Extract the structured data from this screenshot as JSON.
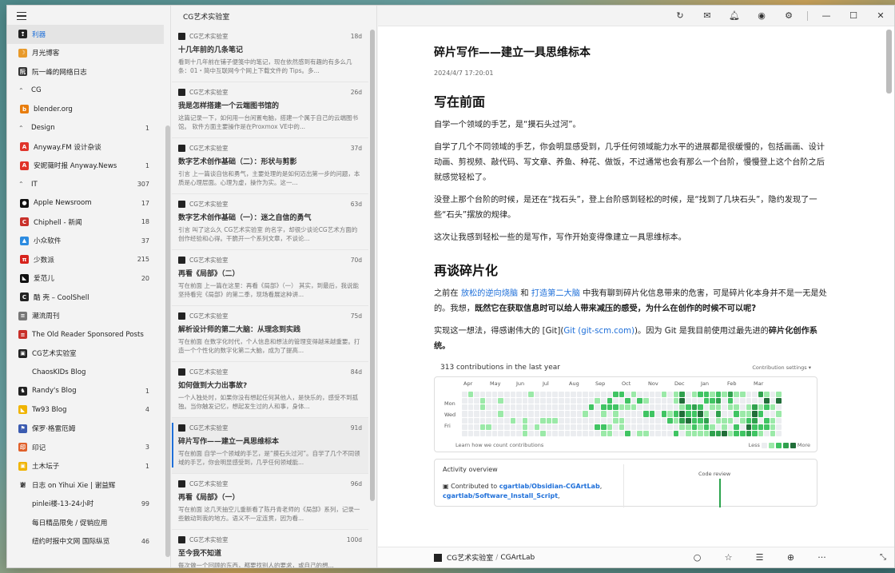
{
  "sidebar": {
    "items": [
      {
        "type": "feed",
        "label": "利器",
        "count": "",
        "selected": true,
        "fav_color": "#222",
        "fav_glyph": "❢"
      },
      {
        "type": "feed",
        "label": "月光博客",
        "count": "",
        "fav_color": "#e89a2b",
        "fav_glyph": "☽"
      },
      {
        "type": "feed",
        "label": "阮一峰的网络日志",
        "count": "",
        "fav_color": "#333",
        "fav_glyph": "阮"
      },
      {
        "type": "group",
        "label": "CG",
        "count": ""
      },
      {
        "type": "feed",
        "label": "blender.org",
        "count": "",
        "fav_color": "#e87d0d",
        "fav_glyph": "b",
        "child": true
      },
      {
        "type": "group",
        "label": "Design",
        "count": "1"
      },
      {
        "type": "feed",
        "label": "Anyway.FM 设计杂谈",
        "count": "",
        "fav_color": "#e0342a",
        "fav_glyph": "A",
        "child": true
      },
      {
        "type": "feed",
        "label": "安妮薇时报 Anyway.News",
        "count": "1",
        "fav_color": "#e0342a",
        "fav_glyph": "A",
        "child": true
      },
      {
        "type": "group",
        "label": "IT",
        "count": "307"
      },
      {
        "type": "feed",
        "label": "Apple Newsroom",
        "count": "17",
        "fav_color": "#111",
        "fav_glyph": "●",
        "child": true
      },
      {
        "type": "feed",
        "label": "Chiphell - 新闻",
        "count": "18",
        "fav_color": "#c8302a",
        "fav_glyph": "C",
        "child": true
      },
      {
        "type": "feed",
        "label": "小众软件",
        "count": "37",
        "fav_color": "#2c8be0",
        "fav_glyph": "▲",
        "child": true
      },
      {
        "type": "feed",
        "label": "少数派",
        "count": "215",
        "fav_color": "#d7231c",
        "fav_glyph": "π",
        "child": true
      },
      {
        "type": "feed",
        "label": "爱范儿",
        "count": "20",
        "fav_color": "#111",
        "fav_glyph": "◣",
        "child": true
      },
      {
        "type": "feed",
        "label": "酷 壳 – CoolShell",
        "count": "",
        "fav_color": "#222",
        "fav_glyph": "C",
        "child": true
      },
      {
        "type": "feed",
        "label": "潮流周刊",
        "count": "",
        "fav_color": "#777",
        "fav_glyph": "≡"
      },
      {
        "type": "feed",
        "label": "The Old Reader Sponsored Posts",
        "count": "",
        "fav_color": "#c8302a",
        "fav_glyph": "≡"
      },
      {
        "type": "feed",
        "label": "CG艺术实验室",
        "count": "",
        "fav_color": "#222",
        "fav_glyph": "▣",
        "active": true
      },
      {
        "type": "feed",
        "label": "ChaosKIDs Blog",
        "count": "",
        "fav_color": "#f3f3f3",
        "fav_glyph": ""
      },
      {
        "type": "feed",
        "label": "Randy's Blog",
        "count": "1",
        "fav_color": "#222",
        "fav_glyph": "♞"
      },
      {
        "type": "feed",
        "label": "Tw93 Blog",
        "count": "4",
        "fav_color": "#f0b400",
        "fav_glyph": "◣"
      },
      {
        "type": "feed",
        "label": "保罗·格雷厄姆",
        "count": "",
        "fav_color": "#3b5bb0",
        "fav_glyph": "⚑"
      },
      {
        "type": "feed",
        "label": "印记",
        "count": "3",
        "fav_color": "#e0602a",
        "fav_glyph": "印"
      },
      {
        "type": "feed",
        "label": "土木坛子",
        "count": "1",
        "fav_color": "#f0b400",
        "fav_glyph": "▣"
      },
      {
        "type": "feed",
        "label": "日志 on Yihui Xie | 谢益辉",
        "count": "",
        "fav_color": "#f3f3f3",
        "fav_glyph": "谢",
        "glyph_color": "#222"
      },
      {
        "type": "feed",
        "label": "pinlei楼-13-24小时",
        "count": "99",
        "fav_color": "#f3f3f3",
        "fav_glyph": ""
      },
      {
        "type": "feed",
        "label": "每日精品限免 / 促销应用",
        "count": "",
        "fav_color": "#f3f3f3",
        "fav_glyph": ""
      },
      {
        "type": "feed",
        "label": "纽约时报中文网 国际纵览",
        "count": "46",
        "fav_color": "#f3f3f3",
        "fav_glyph": ""
      }
    ]
  },
  "article_list": {
    "header": "CG艺术实验室",
    "items": [
      {
        "source": "CG艺术实验室",
        "age": "18d",
        "title": "十几年前的几条笔记",
        "snippet": "看到十几年前在铺子便笺中的笔记，现在依然感到有趣的有多么几条：01・简中互联网今个网上下载文件的 Tips。多..."
      },
      {
        "source": "CG艺术实验室",
        "age": "26d",
        "title": "我是怎样搭建一个云端图书馆的",
        "snippet": "这篇记录一下，如何用一台闲置电脑，搭建一个属于自己的云端图书馆。 软件方面主要操作是在Proxmox VE中的..."
      },
      {
        "source": "CG艺术实验室",
        "age": "37d",
        "title": "数字艺术创作基础（二）：形状与剪影",
        "snippet": "引言 上一篇谈自信和勇气，主要处理的是如何迈出第一步的问题，本质是心理层面。心理为虚，操作为实。这一..."
      },
      {
        "source": "CG艺术实验室",
        "age": "63d",
        "title": "数字艺术创作基础（一）：迷之自信的勇气",
        "snippet": "引言 叫了这么久 CG艺术实验室 的名字，却很少谈论CG艺术方面的创作经验和心得。干脆开一个系列文章，不谈论..."
      },
      {
        "source": "CG艺术实验室",
        "age": "70d",
        "title": "再看《局部》（二）",
        "snippet": "写在前面 上一篇在这里：再看《局部》（一） 其实，到最后，我说能坚持看完《局部》的第二季，现场看展这种讲..."
      },
      {
        "source": "CG艺术实验室",
        "age": "75d",
        "title": "解析设计师的第二大脑：从理念到实践",
        "snippet": "写在前面 在数字化时代，个人信息和想法的管理变得越来越重要。打造一个个性化的数字化第二大脑，成为了提高..."
      },
      {
        "source": "CG艺术实验室",
        "age": "84d",
        "title": "如何做到大力出事故?",
        "snippet": "一个人独处时，如果你没有想起任何其他人，是快乐的，感受不到孤独。当你触发记忆，想起发生过的人和事，身体..."
      },
      {
        "source": "CG艺术实验室",
        "age": "91d",
        "title": "碎片写作——建立一具思维标本",
        "snippet": "写在前面 自学一个领域的手艺，是“摸石头过河”。自学了几个不同领域的手艺，你会明显感受到，几乎任何领域能...",
        "selected": true
      },
      {
        "source": "CG艺术实验室",
        "age": "96d",
        "title": "再看《局部》（一）",
        "snippet": "写在前面 这几天抽空儿重新看了陈丹青老师的《局部》系列，记录一些触动到我的地方。语义不一定连贯，因为看..."
      },
      {
        "source": "CG艺术实验室",
        "age": "100d",
        "title": "至今我不知道",
        "snippet": "每次做一个回顾的东西，都要找别人的要求，或自己的想..."
      }
    ]
  },
  "reader": {
    "title": "碎片写作——建立一具思维标本",
    "date": "2024/4/7 17:20:01",
    "h2_1": "写在前面",
    "p1": "自学一个领域的手艺，是“摸石头过河”。",
    "p2": "自学了几个不同领域的手艺，你会明显感受到，几乎任何领域能力水平的进展都是很缓慢的，包括画画、设计动画、剪视频、敲代码、写文章、养鱼、种花、做饭，不过通常也会有那么一个台阶，慢慢登上这个台阶之后就感觉轻松了。",
    "p3": "没登上那个台阶的时候，是还在“找石头”，登上台阶感到轻松的时候，是“找到了几块石头”，隐约发现了一些“石头”摆放的规律。",
    "p4": "这次让我感到轻松一些的是写作，写作开始变得像建立一具思维标本。",
    "h2_2": "再谈碎片化",
    "p5_a": "之前在 ",
    "p5_link1": "放松的逆向烧脑",
    "p5_b": " 和 ",
    "p5_link2": "打造第二大脑",
    "p5_c": " 中我有聊到碎片化信息带来的危害，可是碎片化本身并不是一无是处的。我想，",
    "p5_bold": "既然它在获取信息时可以给人带来减压的感受，为什么在创作的时候不可以呢?",
    "p6_a": "实现这一想法，得感谢伟大的 [Git](",
    "p6_link": "Git (git-scm.com)",
    "p6_b": ")。因为 Git 是我目前使用过最先进的",
    "p6_bold": "碎片化创作系统。",
    "gh": {
      "contributions": "313 contributions in the last year",
      "settings": "Contribution settings ▾",
      "months": [
        "Apr",
        "May",
        "Jun",
        "Jul",
        "Aug",
        "Sep",
        "Oct",
        "Nov",
        "Dec",
        "Jan",
        "Feb",
        "Mar"
      ],
      "days": [
        "Mon",
        "Wed",
        "Fri"
      ],
      "learn": "Learn how we count contributions",
      "less": "Less",
      "more": "More",
      "activity": "Activity overview",
      "contributed_prefix": "Contributed to ",
      "repo1": "cgartlab/Obsidian-CGArtLab",
      "repo2": "cgartlab/Software_Install_Script",
      "code_review": "Code review"
    }
  },
  "bottombar": {
    "source": "CG艺术实验室",
    "sep": "/",
    "author": "CGArtLab"
  },
  "colors": {
    "accent": "#1e6fd9",
    "gh_green": "#2da44e"
  }
}
